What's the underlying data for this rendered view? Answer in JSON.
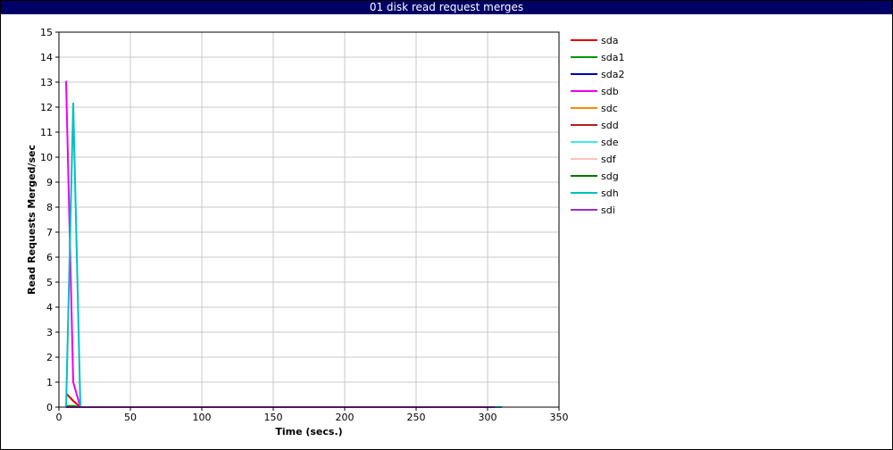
{
  "window": {
    "title": "01 disk read request merges"
  },
  "chart_data": {
    "type": "line",
    "title": "01 disk read request merges",
    "xlabel": "Time (secs.)",
    "ylabel": "Read Requests Merged/sec",
    "xlim": [
      0,
      350
    ],
    "ylim": [
      0,
      15
    ],
    "xticks": [
      0,
      50,
      100,
      150,
      200,
      250,
      300,
      350
    ],
    "yticks": [
      0,
      1,
      2,
      3,
      4,
      5,
      6,
      7,
      8,
      9,
      10,
      11,
      12,
      13,
      14,
      15
    ],
    "grid": true,
    "legend_position": "right",
    "series": [
      {
        "name": "sda",
        "color": "#e00000",
        "x": [
          5,
          10,
          15,
          305
        ],
        "y": [
          0.55,
          0.25,
          0,
          0
        ]
      },
      {
        "name": "sda1",
        "color": "#009900",
        "x": [
          5,
          10,
          15,
          305
        ],
        "y": [
          0.05,
          0.05,
          0,
          0
        ]
      },
      {
        "name": "sda2",
        "color": "#0000b0",
        "x": [
          5,
          10,
          15,
          305
        ],
        "y": [
          0,
          0,
          0,
          0
        ]
      },
      {
        "name": "sdb",
        "color": "#ee00ee",
        "x": [
          5,
          10,
          15,
          305
        ],
        "y": [
          13.05,
          1.0,
          0,
          0
        ]
      },
      {
        "name": "sdc",
        "color": "#f09000",
        "x": [
          5,
          10,
          15,
          305
        ],
        "y": [
          0,
          0,
          0,
          0
        ]
      },
      {
        "name": "sdd",
        "color": "#b02020",
        "x": [
          5,
          10,
          15,
          305
        ],
        "y": [
          0,
          0,
          0,
          0
        ]
      },
      {
        "name": "sde",
        "color": "#40e8e8",
        "x": [
          5,
          10,
          15,
          305
        ],
        "y": [
          0,
          0,
          0,
          0
        ]
      },
      {
        "name": "sdf",
        "color": "#ffc0c0",
        "x": [
          5,
          10,
          15,
          305
        ],
        "y": [
          0,
          0,
          0,
          0
        ]
      },
      {
        "name": "sdg",
        "color": "#007700",
        "x": [
          5,
          10,
          15,
          305
        ],
        "y": [
          0,
          0,
          0,
          0
        ]
      },
      {
        "name": "sdh",
        "color": "#00c0c0",
        "x": [
          5,
          10,
          15,
          310
        ],
        "y": [
          0,
          12.15,
          0,
          0
        ]
      },
      {
        "name": "sdi",
        "color": "#a030c0",
        "x": [
          5,
          10,
          15,
          305
        ],
        "y": [
          0,
          0,
          0,
          0
        ]
      }
    ]
  }
}
